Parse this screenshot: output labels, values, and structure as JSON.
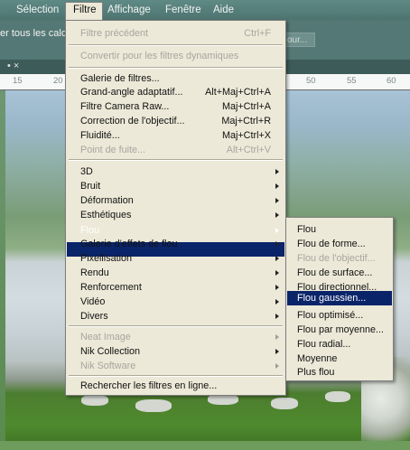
{
  "menubar": {
    "items": [
      "Sélection",
      "Filtre",
      "Affichage",
      "Fenêtre",
      "Aide"
    ]
  },
  "options_bar": {
    "label": "er tous les calqu",
    "button_text": "our..."
  },
  "doc_tab": {
    "close": "• ×"
  },
  "ruler": {
    "ticks": [
      "15",
      "20",
      "50",
      "55",
      "60"
    ]
  },
  "filter_menu": {
    "items": [
      {
        "label": "Filtre précédent",
        "shortcut": "Ctrl+F",
        "disabled": true
      },
      {
        "label": "Convertir pour les filtres dynamiques",
        "disabled": true
      },
      {
        "label": "Galerie de filtres..."
      },
      {
        "label": "Grand-angle adaptatif...",
        "shortcut": "Alt+Maj+Ctrl+A"
      },
      {
        "label": "Filtre Camera Raw...",
        "shortcut": "Maj+Ctrl+A"
      },
      {
        "label": "Correction de l'objectif...",
        "shortcut": "Maj+Ctrl+R"
      },
      {
        "label": "Fluidité...",
        "shortcut": "Maj+Ctrl+X"
      },
      {
        "label": "Point de fuite...",
        "shortcut": "Alt+Ctrl+V",
        "disabled": true
      },
      {
        "label": "3D",
        "submenu": true
      },
      {
        "label": "Bruit",
        "submenu": true
      },
      {
        "label": "Déformation",
        "submenu": true
      },
      {
        "label": "Esthétiques",
        "submenu": true
      },
      {
        "label": "Flou",
        "submenu": true,
        "highlighted": true
      },
      {
        "label": "Galerie d'effets de flou",
        "submenu": true
      },
      {
        "label": "Pixellisation",
        "submenu": true
      },
      {
        "label": "Rendu",
        "submenu": true
      },
      {
        "label": "Renforcement",
        "submenu": true
      },
      {
        "label": "Vidéo",
        "submenu": true
      },
      {
        "label": "Divers",
        "submenu": true
      },
      {
        "label": "Neat Image",
        "submenu": true,
        "disabled": true
      },
      {
        "label": "Nik Collection",
        "submenu": true
      },
      {
        "label": "Nik Software",
        "submenu": true,
        "disabled": true
      },
      {
        "label": "Rechercher les filtres en ligne..."
      }
    ]
  },
  "flou_submenu": {
    "items": [
      {
        "label": "Flou"
      },
      {
        "label": "Flou de forme..."
      },
      {
        "label": "Flou de l'objectif...",
        "disabled": true
      },
      {
        "label": "Flou de surface..."
      },
      {
        "label": "Flou directionnel..."
      },
      {
        "label": "Flou gaussien...",
        "highlighted": true
      },
      {
        "label": "Flou optimisé..."
      },
      {
        "label": "Flou par moyenne..."
      },
      {
        "label": "Flou radial..."
      },
      {
        "label": "Moyenne"
      },
      {
        "label": "Plus flou"
      }
    ]
  },
  "colors": {
    "menu_bg": "#ece9d8",
    "highlight": "#0a246a",
    "titlebar": "#5f8a86"
  }
}
